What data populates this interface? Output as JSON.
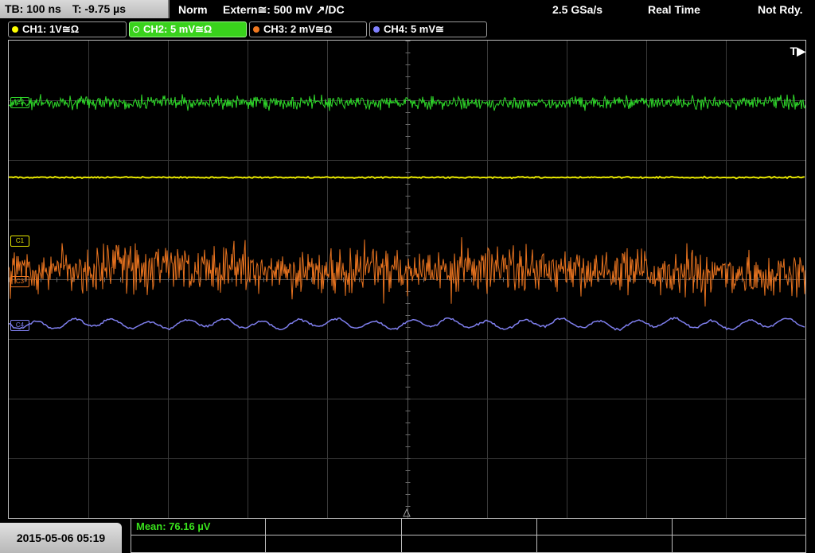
{
  "timebase": {
    "tb": "TB: 100 ns",
    "t": "T: -9.75 µs"
  },
  "trigger": {
    "mode": "Norm",
    "source": "Extern≅: 500 mV ↗/DC",
    "rate": "2.5 GSa/s",
    "acq": "Real Time",
    "status": "Not Rdy."
  },
  "channels": [
    {
      "label": "CH1: 1V≅Ω",
      "color": "#ffff00"
    },
    {
      "label": "CH2: 5 mV≅Ω",
      "color": "#39d21c"
    },
    {
      "label": "CH3: 2 mV≅Ω",
      "color": "#f07820"
    },
    {
      "label": "CH4: 5 mV≅",
      "color": "#8080ff"
    }
  ],
  "markers": {
    "c1": "C1",
    "c2": "C2",
    "c3": "C3",
    "c4": "C4",
    "trig": "T▶"
  },
  "datetime": "2015-05-06 05:19",
  "measurement": {
    "mean": "Mean: 76.16 µV"
  }
}
